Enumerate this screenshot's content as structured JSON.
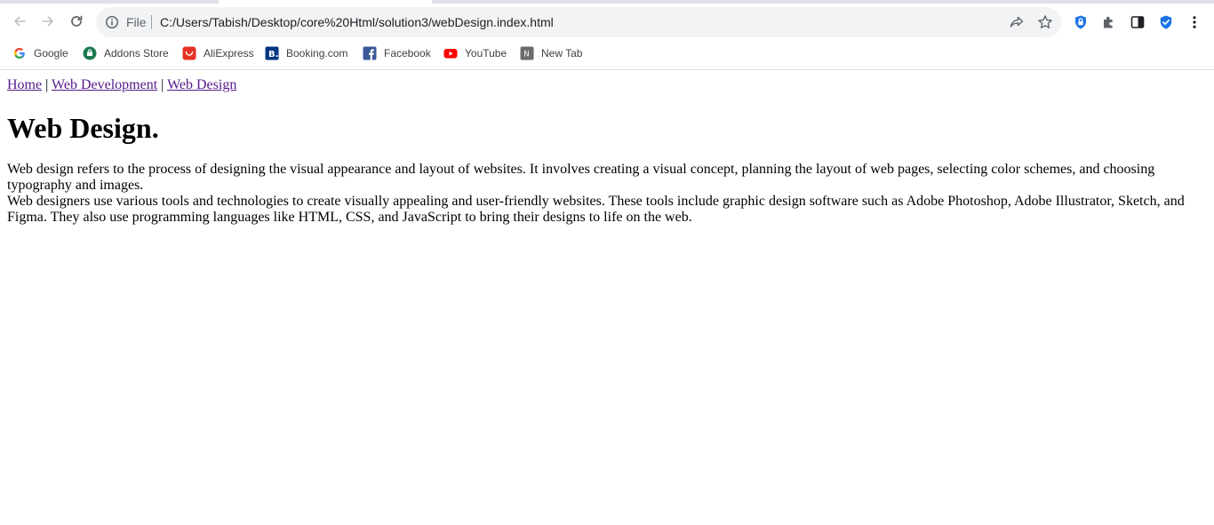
{
  "browser": {
    "omnibox": {
      "scheme_label": "File",
      "url": "C:/Users/Tabish/Desktop/core%20Html/solution3/webDesign.index.html"
    },
    "bookmarks": [
      {
        "label": "Google",
        "icon": "google-icon"
      },
      {
        "label": "Addons Store",
        "icon": "addons-store-icon"
      },
      {
        "label": "AliExpress",
        "icon": "aliexpress-icon"
      },
      {
        "label": "Booking.com",
        "icon": "booking-icon"
      },
      {
        "label": "Facebook",
        "icon": "facebook-icon"
      },
      {
        "label": "YouTube",
        "icon": "youtube-icon"
      },
      {
        "label": "New Tab",
        "icon": "new-tab-icon"
      }
    ],
    "colors": {
      "omnibox_bg": "#f1f3f4",
      "visited_link": "#551a8b",
      "extension_blue": "#1a73e8"
    }
  },
  "page": {
    "nav": {
      "home": "Home",
      "separator": "|",
      "web_development": "Web Development",
      "web_design": "Web Design"
    },
    "title": "Web Design.",
    "paragraphs": [
      "Web design refers to the process of designing the visual appearance and layout of websites. It involves creating a visual concept, planning the layout of web pages, selecting color schemes, and choosing typography and images.",
      "Web designers use various tools and technologies to create visually appealing and user-friendly websites. These tools include graphic design software such as Adobe Photoshop, Adobe Illustrator, Sketch, and Figma. They also use programming languages like HTML, CSS, and JavaScript to bring their designs to life on the web."
    ]
  }
}
